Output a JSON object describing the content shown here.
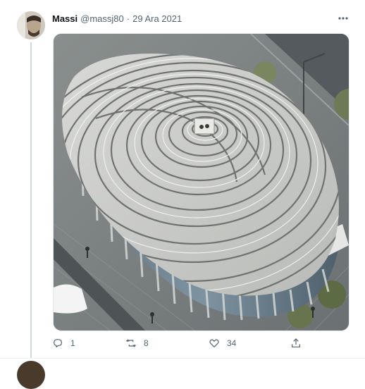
{
  "tweet": {
    "author_name": "Massi",
    "author_handle": "@massj80",
    "separator": "·",
    "date": "29 Ara 2021",
    "more_label": "···",
    "media_alt": "fingerprint-shaped building"
  },
  "actions": {
    "reply_count": "1",
    "retweet_count": "8",
    "like_count": "34"
  },
  "icons": {
    "avatar": "avatar-icon",
    "more": "more-icon",
    "reply": "reply-icon",
    "retweet": "retweet-icon",
    "like": "heart-icon",
    "share": "share-icon"
  },
  "colors": {
    "text_primary": "#0f1419",
    "text_secondary": "#536471",
    "thread_line": "#cfd9de"
  }
}
